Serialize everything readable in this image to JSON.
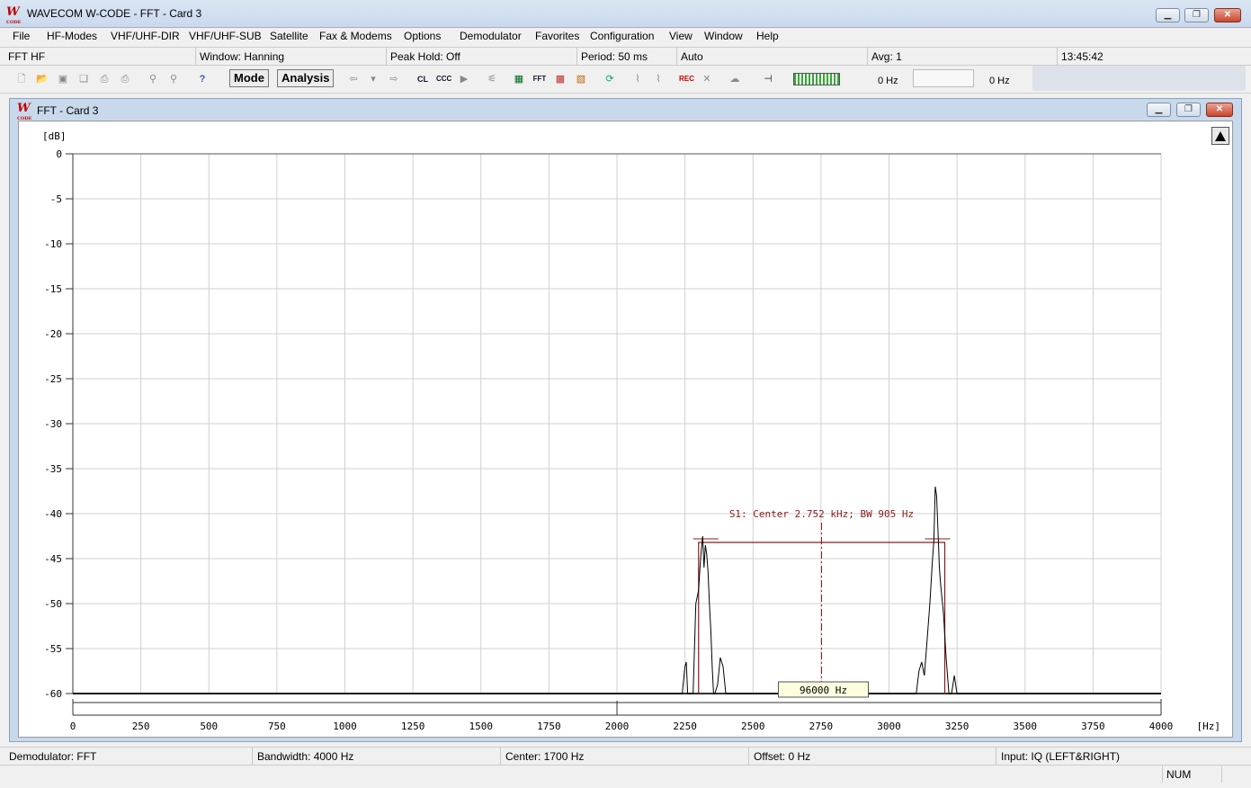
{
  "window": {
    "title": "WAVECOM W-CODE - FFT  - Card 3",
    "logo_letter": "W",
    "logo_sub": "CODE"
  },
  "menu": [
    "File",
    "HF-Modes",
    "VHF/UHF-DIR",
    "VHF/UHF-SUB",
    "Satellite",
    "Fax & Modems",
    "Options",
    "Demodulator",
    "Favorites",
    "Configuration",
    "View",
    "Window",
    "Help"
  ],
  "status_top": {
    "mode": "FFT HF",
    "window": "Window: Hanning",
    "peak_hold": "Peak Hold: Off",
    "period": "Period: 50 ms",
    "auto": "Auto",
    "avg": "Avg: 1",
    "time": "13:45:42"
  },
  "toolbar": {
    "mode_label": "Mode",
    "analysis_label": "Analysis",
    "freq_left": "0 Hz",
    "freq_right": "0 Hz"
  },
  "child_window": {
    "title": "FFT  - Card 3"
  },
  "chart_data": {
    "type": "line",
    "ylabel": "[dB]",
    "xlabel": "[Hz]",
    "xlim": [
      0,
      4000
    ],
    "ylim": [
      -60,
      0
    ],
    "x_ticks": [
      0,
      250,
      500,
      750,
      1000,
      1250,
      1500,
      1750,
      2000,
      2250,
      2500,
      2750,
      3000,
      3250,
      3500,
      3750,
      4000
    ],
    "y_ticks": [
      0,
      -5,
      -10,
      -15,
      -20,
      -25,
      -30,
      -35,
      -40,
      -45,
      -50,
      -55,
      -60
    ],
    "grid": true,
    "series": [
      {
        "x": [
          0,
          2240,
          2250,
          2255,
          2260,
          2270,
          2280,
          2290,
          2300,
          2305,
          2310,
          2315,
          2320,
          2325,
          2330,
          2335,
          2340,
          2345,
          2350,
          2355,
          2360,
          2370,
          2380,
          2390,
          2400,
          2410,
          2420,
          3100,
          3110,
          3120,
          3130,
          3140,
          3150,
          3160,
          3165,
          3170,
          3175,
          3180,
          3185,
          3190,
          3200,
          3210,
          3220,
          3230,
          3240,
          3250,
          3260,
          4000
        ],
        "y": [
          -60,
          -60,
          -57,
          -56.5,
          -60,
          -60,
          -60,
          -50,
          -48.5,
          -46,
          -44,
          -42.5,
          -46,
          -43.5,
          -44.5,
          -46.5,
          -50,
          -53,
          -57,
          -60,
          -60,
          -59,
          -56,
          -57,
          -60,
          -60,
          -60,
          -60,
          -57.5,
          -56.5,
          -58,
          -54,
          -50,
          -45,
          -43,
          -37,
          -38,
          -42,
          -46,
          -48,
          -51,
          -56,
          -60,
          -60,
          -58,
          -60,
          -60,
          -60
        ]
      }
    ],
    "annotation": "S1: Center 2.752 kHz; BW 905 Hz",
    "marker_label": "96000 Hz",
    "selection": {
      "start_hz": 2300,
      "end_hz": 3205,
      "center_hz": 2752,
      "level_db": -43.2
    }
  },
  "status_bottom": {
    "demodulator": "Demodulator: FFT",
    "bandwidth": "Bandwidth: 4000 Hz",
    "center": "Center: 1700 Hz",
    "offset": "Offset: 0 Hz",
    "input": "Input: IQ (LEFT&RIGHT)",
    "num": "NUM"
  },
  "colors": {
    "selection": "#8b1a1a",
    "trace": "#000000",
    "grid": "#d0d0d0"
  }
}
